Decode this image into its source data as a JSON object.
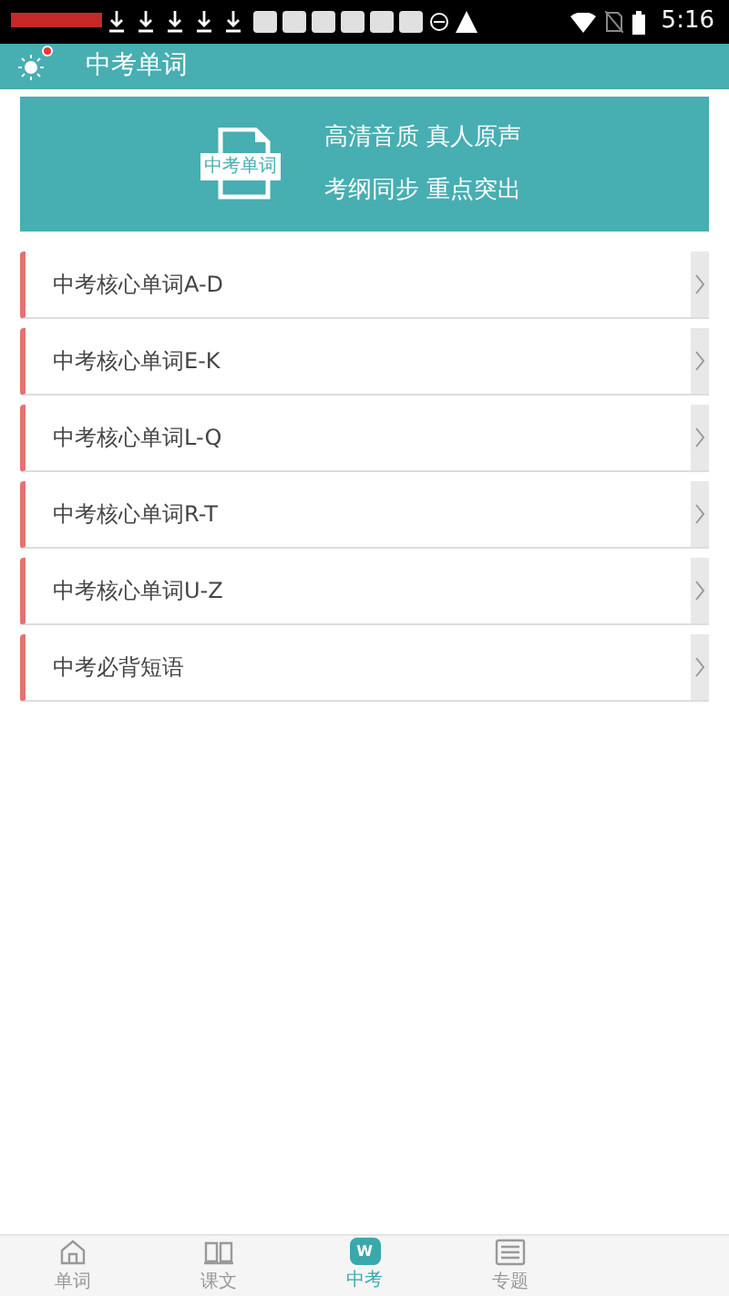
{
  "status_bar": {
    "time": "5:16"
  },
  "app_bar": {
    "title": "中考单词",
    "notification_dot": true
  },
  "banner": {
    "icon_label": "中考单词",
    "lines": [
      "高清音质 真人原声",
      "考纲同步 重点突出"
    ]
  },
  "list": [
    {
      "label": "中考核心单词A-D"
    },
    {
      "label": "中考核心单词E-K"
    },
    {
      "label": "中考核心单词L-Q"
    },
    {
      "label": "中考核心单词R-T"
    },
    {
      "label": "中考核心单词U-Z"
    },
    {
      "label": "中考必背短语"
    }
  ],
  "tabs": [
    {
      "label": "单词",
      "kind": "home",
      "selected": false
    },
    {
      "label": "课文",
      "kind": "book",
      "selected": false
    },
    {
      "label": "中考",
      "kind": "badge",
      "badge_text": "W",
      "selected": true
    },
    {
      "label": "专题",
      "kind": "list",
      "selected": false
    }
  ]
}
